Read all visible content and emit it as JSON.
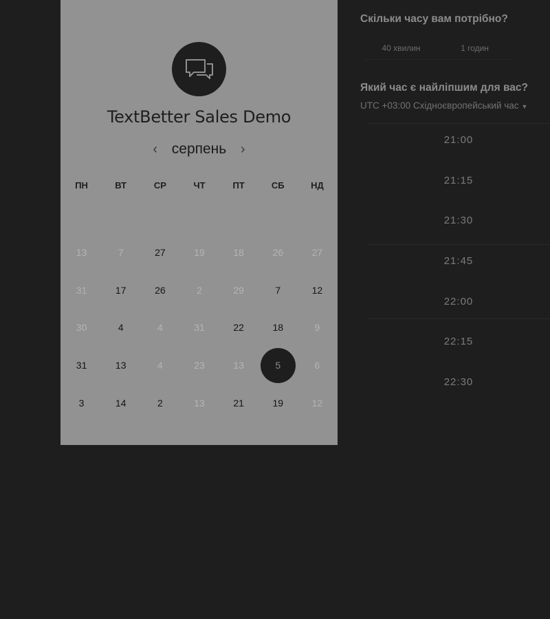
{
  "brand": {
    "title": "TextBetter Sales Demo",
    "icon": "chat-bubbles-icon"
  },
  "calendar": {
    "month": "серпень",
    "prev_arrow": "‹",
    "next_arrow": "›",
    "weekdays": [
      "ПН",
      "ВТ",
      "СР",
      "ЧТ",
      "ПТ",
      "СБ",
      "НД"
    ],
    "rows": [
      [
        {
          "d": "13",
          "s": "off"
        },
        {
          "d": "7",
          "s": "off"
        },
        {
          "d": "27",
          "s": "on"
        },
        {
          "d": "19",
          "s": "off"
        },
        {
          "d": "18",
          "s": "off"
        },
        {
          "d": "26",
          "s": "off"
        },
        {
          "d": "27",
          "s": "off"
        }
      ],
      [
        {
          "d": "31",
          "s": "off"
        },
        {
          "d": "17",
          "s": "on"
        },
        {
          "d": "26",
          "s": "on"
        },
        {
          "d": "2",
          "s": "off"
        },
        {
          "d": "29",
          "s": "off"
        },
        {
          "d": "7",
          "s": "on"
        },
        {
          "d": "12",
          "s": "on"
        }
      ],
      [
        {
          "d": "30",
          "s": "off"
        },
        {
          "d": "4",
          "s": "on"
        },
        {
          "d": "4",
          "s": "off"
        },
        {
          "d": "31",
          "s": "off"
        },
        {
          "d": "22",
          "s": "on"
        },
        {
          "d": "18",
          "s": "on"
        },
        {
          "d": "9",
          "s": "off"
        }
      ],
      [
        {
          "d": "31",
          "s": "on"
        },
        {
          "d": "13",
          "s": "on"
        },
        {
          "d": "4",
          "s": "off"
        },
        {
          "d": "23",
          "s": "off"
        },
        {
          "d": "13",
          "s": "off"
        },
        {
          "d": "5",
          "s": "sel"
        },
        {
          "d": "6",
          "s": "off"
        }
      ],
      [
        {
          "d": "3",
          "s": "on"
        },
        {
          "d": "14",
          "s": "on"
        },
        {
          "d": "2",
          "s": "on"
        },
        {
          "d": "13",
          "s": "off"
        },
        {
          "d": "21",
          "s": "on"
        },
        {
          "d": "19",
          "s": "on"
        },
        {
          "d": "12",
          "s": "off"
        }
      ]
    ]
  },
  "duration": {
    "question": "Скільки часу вам потрібно?",
    "options": [
      "40 хвилин",
      "1 годин"
    ]
  },
  "time": {
    "question": "Який час є найліпшим для вас?",
    "timezone": "UTC +03:00 Східноєвропейський час",
    "slots": [
      "21:00",
      "21:15",
      "21:30",
      "21:45",
      "22:00",
      "22:15",
      "22:30"
    ]
  }
}
